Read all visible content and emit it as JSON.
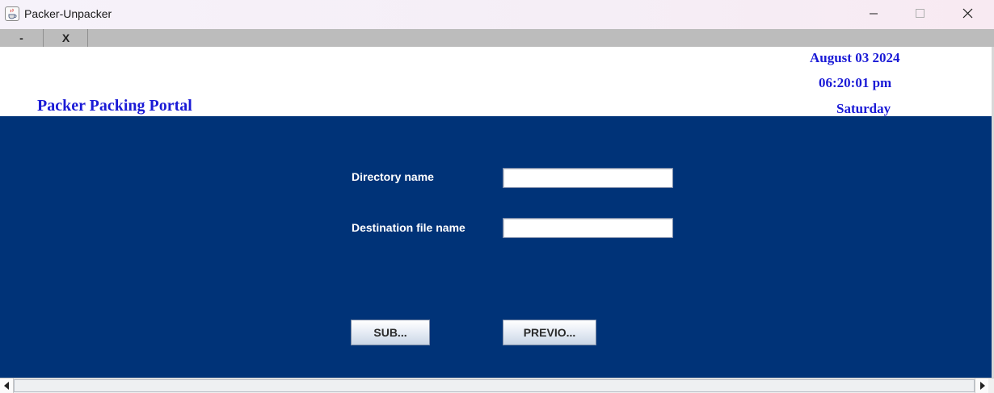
{
  "window": {
    "title": "Packer-Unpacker",
    "icon": "java-cup-icon"
  },
  "menustrip": {
    "minimize_label": "-",
    "close_label": "X"
  },
  "header": {
    "portal_title": "Packer Packing Portal",
    "date": "August 03 2024",
    "time": "06:20:01 pm",
    "day": "Saturday"
  },
  "form": {
    "directory_label": "Directory name",
    "directory_value": "",
    "destination_label": "Destination file name",
    "destination_value": "",
    "submit_label": "SUB...",
    "previous_label": "PREVIO..."
  },
  "colors": {
    "panel_bg": "#003378",
    "header_text": "#1a1ad6",
    "menustrip_bg": "#bcbcbc"
  }
}
